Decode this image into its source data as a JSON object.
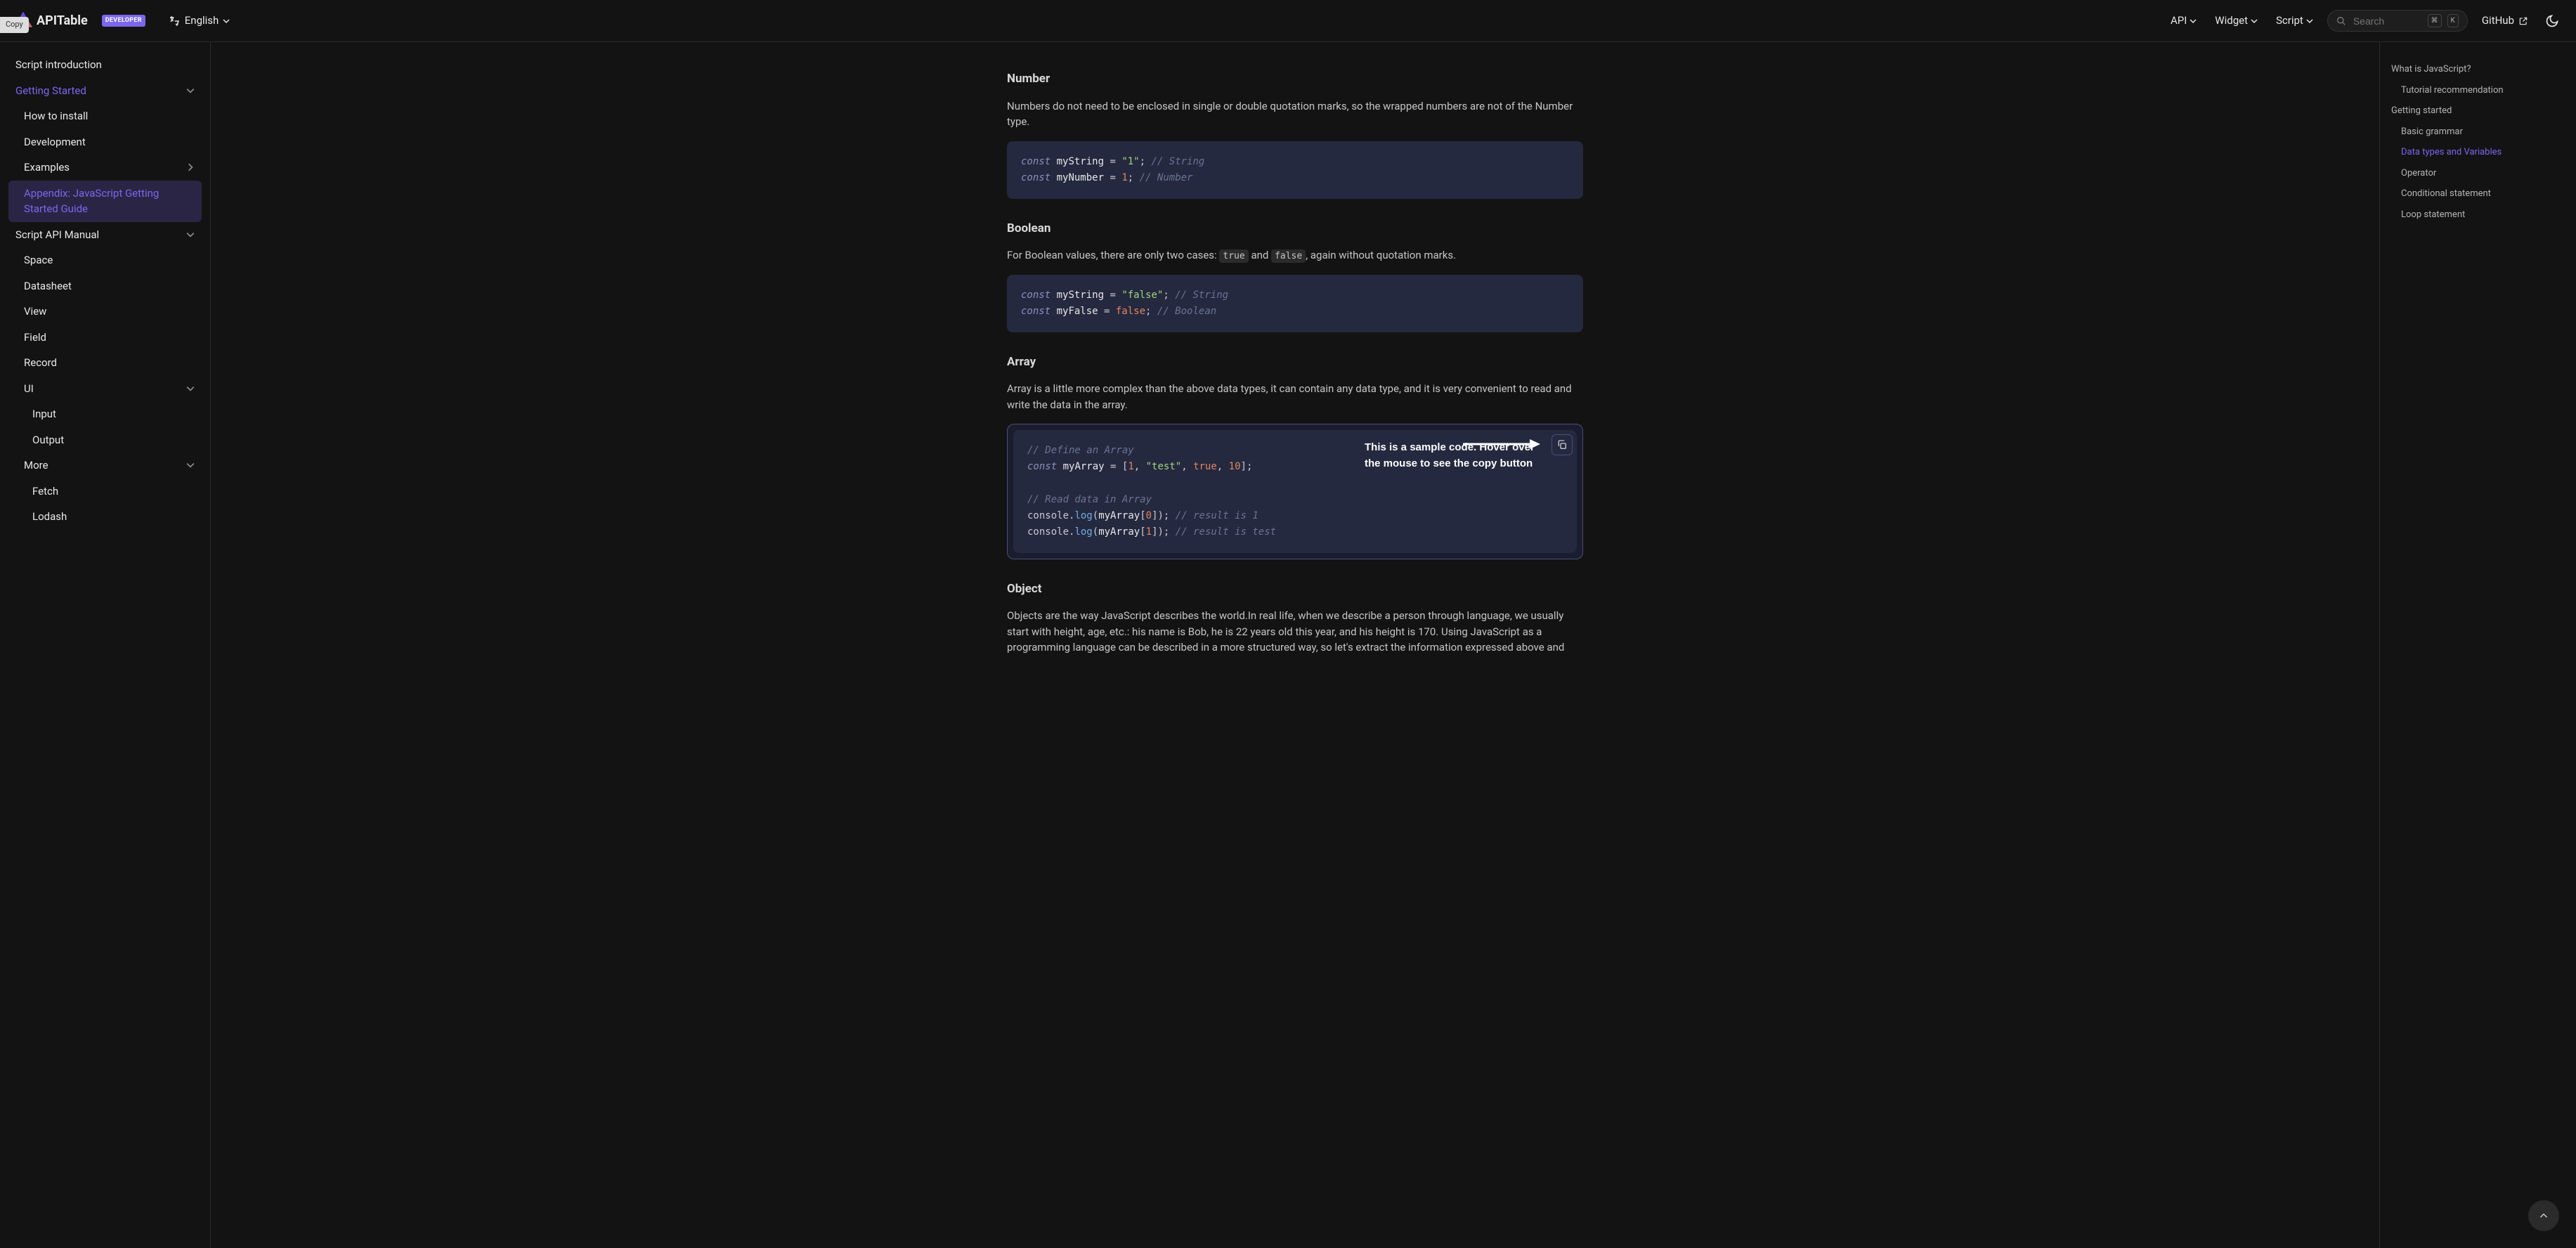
{
  "copy_pill": "Copy",
  "brand": {
    "name": "APITable",
    "dev_badge": "DEVELOPER"
  },
  "lang": {
    "label": "English"
  },
  "nav": {
    "api": "API",
    "widget": "Widget",
    "script": "Script",
    "search_placeholder": "Search",
    "kbd1": "⌘",
    "kbd2": "K",
    "github": "GitHub"
  },
  "sidebar": {
    "items": [
      {
        "label": "Script introduction",
        "level": 0
      },
      {
        "label": "Getting Started",
        "level": 0,
        "accent": true,
        "chev": "down"
      },
      {
        "label": "How to install",
        "level": 1
      },
      {
        "label": "Development",
        "level": 1
      },
      {
        "label": "Examples",
        "level": 1,
        "chev": "right"
      },
      {
        "label": "Appendix: JavaScript Getting Started Guide",
        "level": 1,
        "active": true
      },
      {
        "label": "Script API Manual",
        "level": 0,
        "chev": "down"
      },
      {
        "label": "Space",
        "level": 1
      },
      {
        "label": "Datasheet",
        "level": 1
      },
      {
        "label": "View",
        "level": 1
      },
      {
        "label": "Field",
        "level": 1
      },
      {
        "label": "Record",
        "level": 1
      },
      {
        "label": "UI",
        "level": 1,
        "chev": "down"
      },
      {
        "label": "Input",
        "level": 2
      },
      {
        "label": "Output",
        "level": 2
      },
      {
        "label": "More",
        "level": 1,
        "chev": "down"
      },
      {
        "label": "Fetch",
        "level": 2
      },
      {
        "label": "Lodash",
        "level": 2
      }
    ]
  },
  "sections": {
    "number": {
      "title": "Number",
      "body": "Numbers do not need to be enclosed in single or double quotation marks, so the wrapped numbers are not of the Number type."
    },
    "boolean": {
      "title": "Boolean",
      "body_pre": "For Boolean values, there are only two cases: ",
      "true": "true",
      "and": " and ",
      "false": "false",
      "body_post": ", again without quotation marks."
    },
    "array": {
      "title": "Array",
      "body": "Array is a little more complex than the above data types, it can contain any data type, and it is very convenient to read and write the data in the array."
    },
    "object": {
      "title": "Object",
      "body": "Objects are the way JavaScript describes the world.In real life, when we describe a person through language, we usually start with height, age, etc.: his name is Bob, he is 22 years old this year, and his height is 170. Using JavaScript as a programming language can be described in a more structured way, so let's extract the information expressed above and"
    }
  },
  "code": {
    "number": {
      "l1_kw": "const",
      "l1_id": " myString ",
      "l1_eq": "=",
      "l1_str": " \"1\"",
      "l1_semi": ";",
      "l1_cmt": " // String",
      "l2_kw": "const",
      "l2_id": " myNumber ",
      "l2_eq": "=",
      "l2_num": " 1",
      "l2_semi": ";",
      "l2_cmt": " // Number"
    },
    "boolean": {
      "l1_kw": "const",
      "l1_id": " myString ",
      "l1_eq": "=",
      "l1_str": " \"false\"",
      "l1_semi": ";",
      "l1_cmt": " // String",
      "l2_kw": "const",
      "l2_id": " myFalse ",
      "l2_eq": "=",
      "l2_bool": " false",
      "l2_semi": ";",
      "l2_cmt": " // Boolean"
    },
    "array": {
      "c1": "// Define an Array",
      "l2_kw": "const",
      "l2_id": " myArray ",
      "l2_eq": "=",
      "l2_open": " [",
      "l2_n1": "1",
      "l2_c1": ",",
      "l2_s": " \"test\"",
      "l2_c2": ",",
      "l2_b": " true",
      "l2_c3": ",",
      "l2_n2": " 10",
      "l2_close": "];",
      "c2": "// Read data in Array",
      "l4_obj": "console",
      "l4_dot": ".",
      "l4_fn": "log",
      "l4_open": "(",
      "l4_arr": "myArray",
      "l4_br": "[",
      "l4_idx": "0",
      "l4_close": "]);",
      "l4_cmt": " // result is 1",
      "l5_obj": "console",
      "l5_dot": ".",
      "l5_fn": "log",
      "l5_open": "(",
      "l5_arr": "myArray",
      "l5_br": "[",
      "l5_idx": "1",
      "l5_close": "]);",
      "l5_cmt": " // result is test"
    }
  },
  "annotation": "This is a sample code. Hover over the mouse to see the copy button",
  "toc": {
    "items": [
      {
        "label": "What is JavaScript?",
        "level": 0
      },
      {
        "label": "Tutorial recommendation",
        "level": 1
      },
      {
        "label": "Getting started",
        "level": 0
      },
      {
        "label": "Basic grammar",
        "level": 1
      },
      {
        "label": "Data types and Variables",
        "level": 1,
        "active": true
      },
      {
        "label": "Operator",
        "level": 1
      },
      {
        "label": "Conditional statement",
        "level": 1
      },
      {
        "label": "Loop statement",
        "level": 1
      }
    ]
  }
}
